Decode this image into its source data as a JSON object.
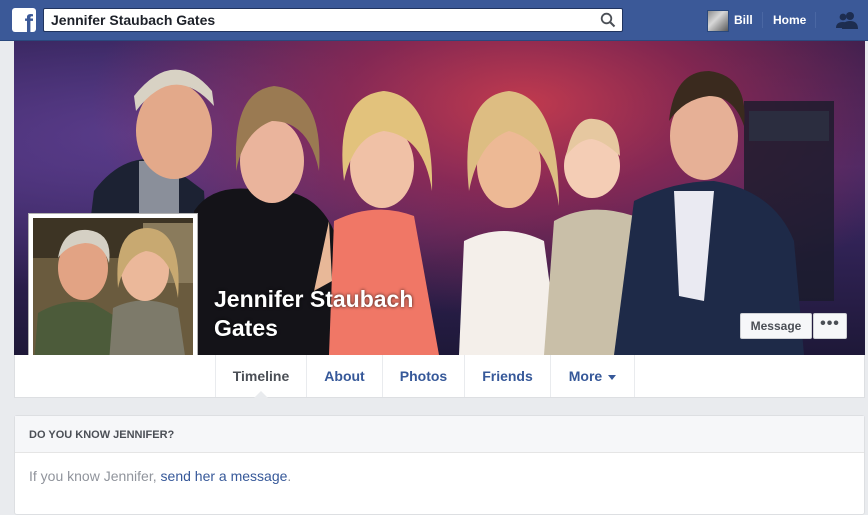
{
  "topbar": {
    "search_value": "Jennifer Staubach Gates",
    "user_name": "Bill",
    "home_label": "Home"
  },
  "profile": {
    "name_line1": "Jennifer Staubach",
    "name_line2": "Gates",
    "message_button": "Message",
    "more_button": "•••"
  },
  "tabs": [
    {
      "label": "Timeline"
    },
    {
      "label": "About"
    },
    {
      "label": "Photos"
    },
    {
      "label": "Friends"
    },
    {
      "label": "More"
    }
  ],
  "know": {
    "heading": "DO YOU KNOW JENNIFER?",
    "text_prefix": "If you know Jennifer, ",
    "link_text": "send her a message",
    "text_suffix": "."
  },
  "colors": {
    "brand": "#3b5998",
    "link": "#365899"
  }
}
